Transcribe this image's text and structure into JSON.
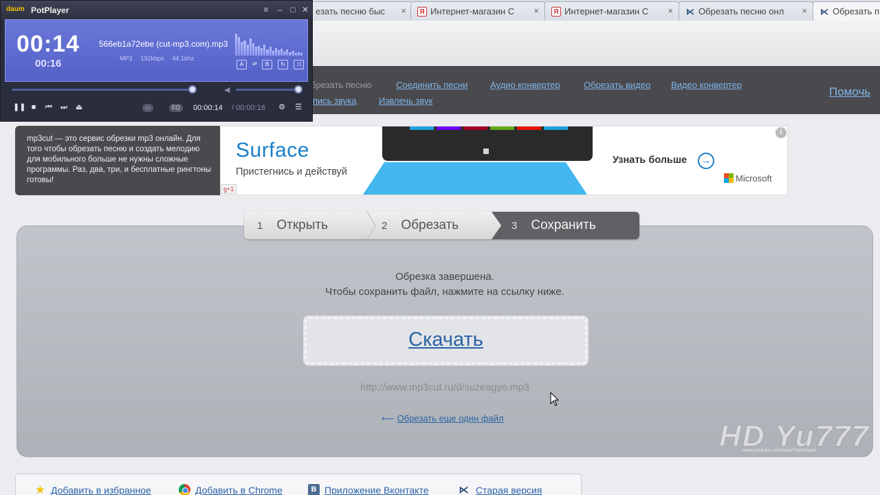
{
  "browser": {
    "tabs": [
      {
        "label": "езать песню быс",
        "icon": "yandex-icon"
      },
      {
        "label": "Интернет-магазин С",
        "icon": "yandex-icon"
      },
      {
        "label": "Интернет-магазин С",
        "icon": "yandex-icon"
      },
      {
        "label": "Обрезать песню онл",
        "icon": "mp3cut-icon"
      },
      {
        "label": "Обрезать п",
        "icon": "mp3cut-icon"
      }
    ],
    "tab_close": "×"
  },
  "nav": {
    "row1": [
      "брезать песню",
      "Соединить песни",
      "Аудио конвертер",
      "Обрезать видео",
      "Видео конвертер"
    ],
    "row2": [
      "пись звука",
      "Извлечь звук"
    ],
    "help": "Помочь "
  },
  "info_text": "mp3cut — это сервис обрезки mp3 онлайн. Для того чтобы обрезать песню и создать мелодию для мобильного больше не нужны сложные программы. Раз, два, три, и бесплатные рингтоны готовы!",
  "ad": {
    "title": "Surface",
    "subtitle": "Пристегнись и действуй",
    "cta": "Узнать больше",
    "brand": "Microsoft",
    "gplus": "g+1",
    "tile_colors": [
      "#1ba1e2",
      "#6a00ff",
      "#a20025",
      "#60a917",
      "#e51400",
      "#1ba1e2"
    ]
  },
  "steps": [
    {
      "num": "1",
      "label": "Открыть"
    },
    {
      "num": "2",
      "label": "Обрезать"
    },
    {
      "num": "3",
      "label": "Сохранить"
    }
  ],
  "result": {
    "line1": "Обрезка завершена.",
    "line2": "Чтобы сохранить файл, нажмите на ссылку ниже.",
    "download_label": "Скачать",
    "download_url": "http://www.mp3cut.ru/d/suzeagyo.mp3",
    "again_arrow": "⟵",
    "again_label": "Обрезать еще один файл"
  },
  "footer": [
    {
      "label": "Добавить в избранное",
      "icon": "star-icon"
    },
    {
      "label": "Добавить в Chrome",
      "icon": "chrome-icon"
    },
    {
      "label": "Приложение Вконтакте",
      "icon": "vk-icon"
    },
    {
      "label": "Старая версия",
      "icon": "mp3cut-icon"
    }
  ],
  "watermark": {
    "text": "HD Yu777",
    "sub": "www.youtube.com/user/YuksSuper"
  },
  "potplayer": {
    "logo": "daum",
    "name": "PotPlayer",
    "time_large": "00:14",
    "time_small": "00:16",
    "filename": "566eb1a72ebe (cut-mp3.com).mp3",
    "meta": [
      "MP3",
      "192kbps",
      "44.1khz"
    ],
    "mini_buttons": [
      "A",
      "⇄",
      "B",
      "↻",
      "⤨"
    ],
    "chip_left": "▭",
    "chip_eq": "EQ",
    "current": "00:00:14",
    "total": "/ 00:00:16",
    "seek_position": 0.875,
    "volume_level": 1.0,
    "spectrum": [
      0.9,
      0.75,
      0.55,
      0.6,
      0.45,
      0.7,
      0.5,
      0.35,
      0.4,
      0.3,
      0.45,
      0.25,
      0.35,
      0.2,
      0.3,
      0.22,
      0.28,
      0.18,
      0.25,
      0.15,
      0.2,
      0.12,
      0.15,
      0.1
    ]
  }
}
